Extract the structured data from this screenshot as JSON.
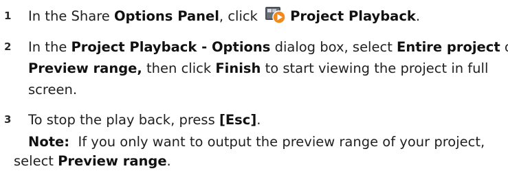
{
  "steps": [
    {
      "number": "1",
      "a": "In the Share ",
      "b": "Options Panel",
      "c": ", click ",
      "icon": "project-playback-icon",
      "d": "Project Playback",
      "e": "."
    },
    {
      "number": "2",
      "l1_a": "In the ",
      "l1_b": "Project Playback - Options",
      "l1_c": " dialog box, select ",
      "l1_d": "Entire project",
      "l1_e": " or",
      "l2_a": "Preview range,",
      "l2_b": " then click ",
      "l2_c": "Finish",
      "l2_d": " to start viewing the project in full",
      "l3": "screen."
    },
    {
      "number": "3",
      "a": "To stop the play back, press ",
      "b": "[Esc]",
      "c": "."
    }
  ],
  "note": {
    "label": "Note:",
    "text": "  If you only want to output the preview range of your project,",
    "line2_a": "select ",
    "line2_b": "Preview range",
    "line2_c": "."
  },
  "colors": {
    "icon_body": "#3a3d44",
    "icon_play": "#f08a1c"
  }
}
